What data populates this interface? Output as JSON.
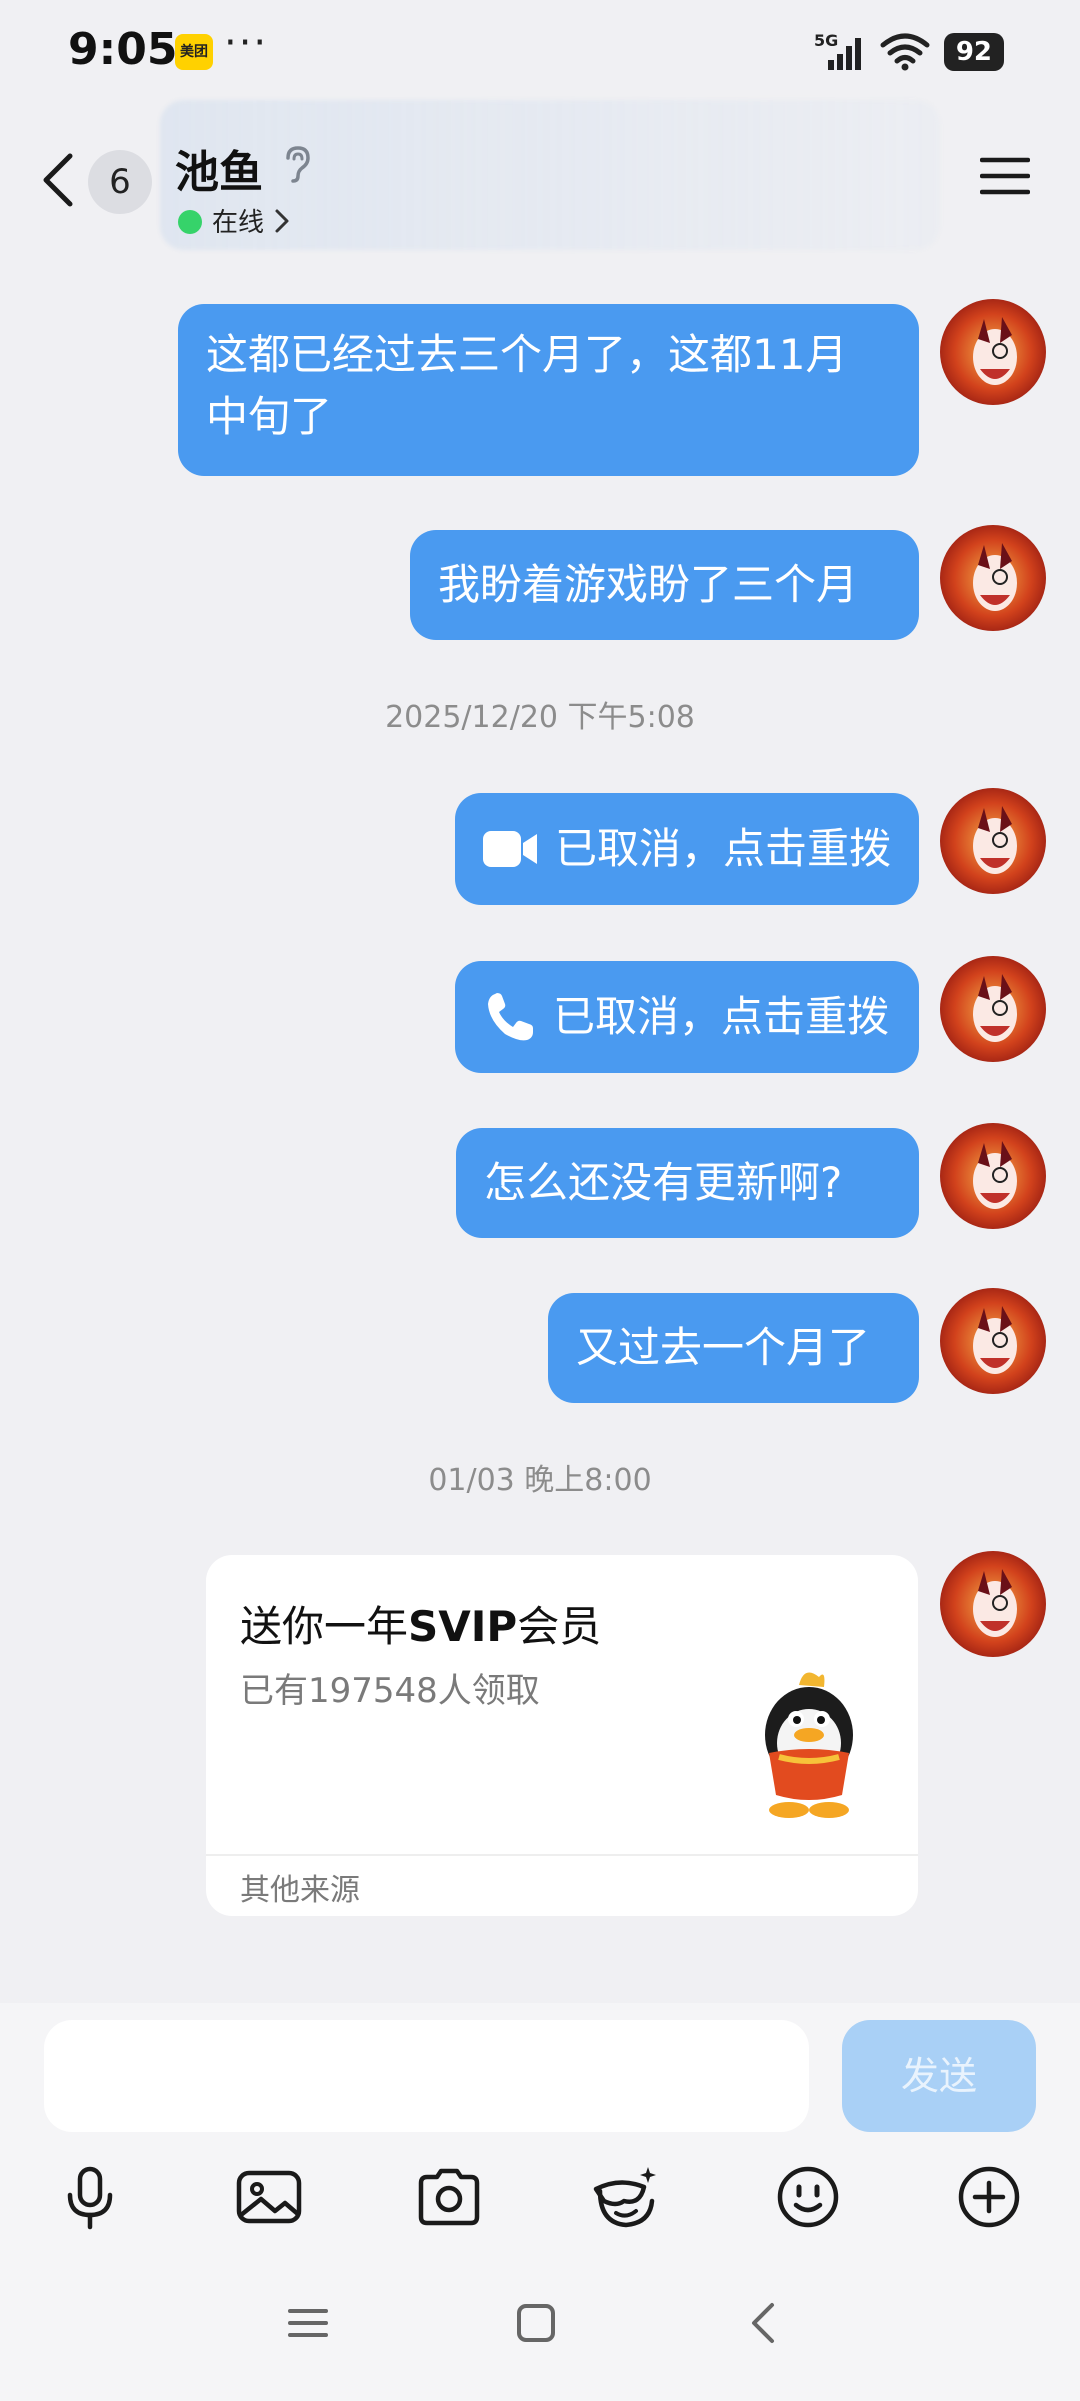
{
  "status_bar": {
    "time": "9:05",
    "app_badge": "美团",
    "more": "···",
    "network": "5G",
    "battery": "92"
  },
  "header": {
    "unread_count": "6",
    "contact_name": "池鱼",
    "status": "在线"
  },
  "messages": [
    {
      "type": "text",
      "lines": [
        "这都已经过去三个月了，这都11月",
        "中旬了"
      ]
    },
    {
      "type": "text",
      "lines": [
        "我盼着游戏盼了三个月"
      ]
    },
    {
      "type": "time",
      "text": "2025/12/20 下午5:08"
    },
    {
      "type": "call",
      "icon": "video-camera-icon",
      "text": "已取消，点击重拨"
    },
    {
      "type": "call",
      "icon": "phone-icon",
      "text": "已取消，点击重拨"
    },
    {
      "type": "text",
      "lines": [
        "怎么还没有更新啊?"
      ]
    },
    {
      "type": "text",
      "lines": [
        "又过去一个月了"
      ]
    },
    {
      "type": "time",
      "text": "01/03 晚上8:00"
    }
  ],
  "card": {
    "title_prefix": "送你一年",
    "title_bold": "SVIP",
    "title_suffix": "会员",
    "subtitle": "已有197548人领取",
    "footer": "其他来源"
  },
  "composer": {
    "placeholder": "",
    "send_label": "发送"
  },
  "toolbar_icons": [
    "microphone-icon",
    "image-icon",
    "camera-icon",
    "sticker-icon",
    "emoji-icon",
    "plus-icon"
  ],
  "nav_icons": [
    "menu-nav-icon",
    "home-nav-icon",
    "back-nav-icon"
  ],
  "colors": {
    "bubble": "#4a9af0",
    "background": "#f0f0f3",
    "send_disabled": "#a9d0f6",
    "online": "#36d36a"
  }
}
